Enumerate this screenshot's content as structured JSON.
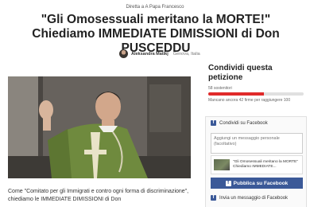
{
  "header": {
    "recipient": "Diretta a A Papa Francesco",
    "title": "\"Gli Omosessuali meritano la MORTE!\" Chiediamo IMMEDIATE DIMISSIONI di Don PUSCEDDU"
  },
  "author": {
    "name": "Aleksandra Matikj",
    "location": "Genova, Italia"
  },
  "petition": {
    "body": "Come \"Comitato per gli Immigrati e contro ogni forma di discriminazione\", chiediamo le IMMEDIATE DIMISSIONI di Don"
  },
  "sidebar": {
    "title": "Condividi questa petizione",
    "signatures": "58 sostenitori",
    "progress_fraction": 0.58,
    "remaining": "Mancano ancora 42 firme per raggiungere 100",
    "share": {
      "heading": "Condividi su Facebook",
      "message_placeholder": "Aggiungi un messaggio personale (facoltativo)",
      "preview_text": "\"Gli Omosessuali meritano la MORTE\" Chiediamo IMMEDIATE...",
      "publish_label": "Pubblica su Facebook",
      "message_link": "Invia un messaggio di Facebook"
    }
  },
  "colors": {
    "progress": "#e02a2a",
    "facebook": "#3b5998"
  },
  "icons": {
    "facebook": "facebook-icon"
  }
}
